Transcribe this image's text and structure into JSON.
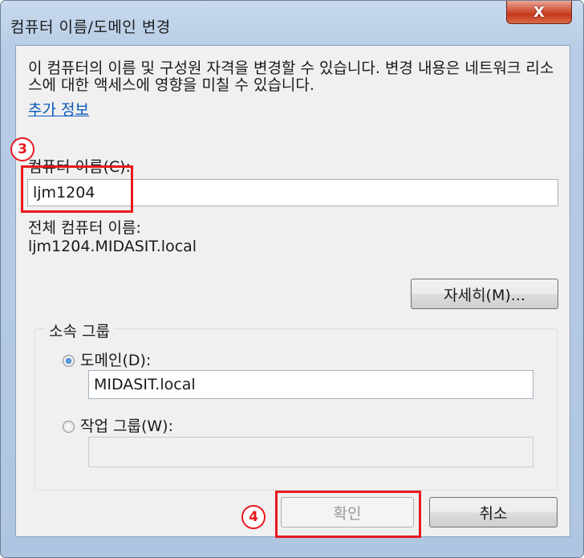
{
  "window": {
    "title": "컴퓨터 이름/도메인 변경",
    "close_label": "X"
  },
  "description": "이 컴퓨터의 이름 및 구성원 자격을 변경할 수 있습니다. 변경 내용은 네트워크 리소스에 대한 액세스에 영향을 미칠 수 있습니다.",
  "more_info_link": "추가 정보",
  "computer_name": {
    "label": "컴퓨터 이름(C):",
    "value": "ljm1204"
  },
  "full_name": {
    "label": "전체 컴퓨터 이름:",
    "value": "ljm1204.MIDASIT.local"
  },
  "more_button": "자세히(M)...",
  "member_of": {
    "legend": "소속 그룹",
    "domain_label": "도메인(D):",
    "domain_value": "MIDASIT.local",
    "domain_selected": true,
    "workgroup_label": "작업 그룹(W):",
    "workgroup_value": ""
  },
  "buttons": {
    "ok": "확인",
    "cancel": "취소"
  },
  "annotations": {
    "step3": "3",
    "step4": "4",
    "color": "#e8191f"
  }
}
